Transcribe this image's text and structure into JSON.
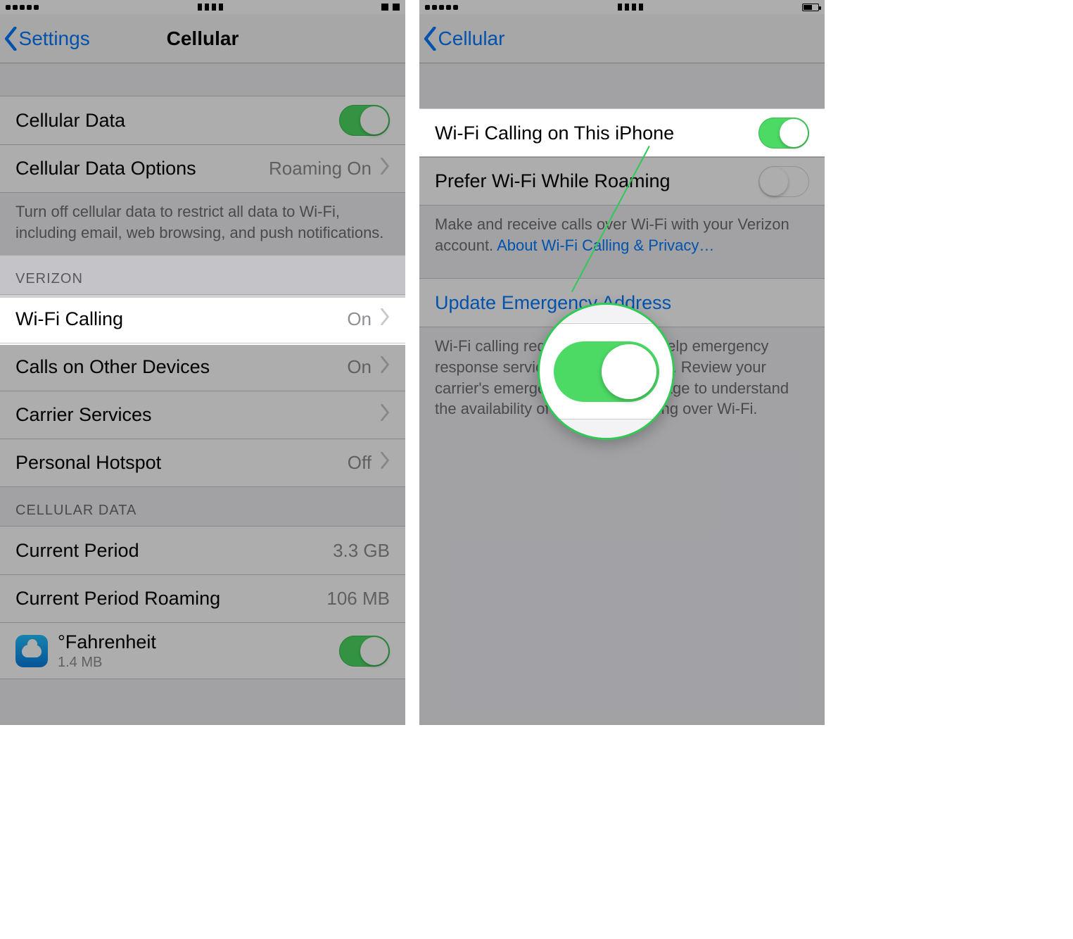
{
  "left": {
    "back_label": "Settings",
    "title": "Cellular",
    "cellular_data": "Cellular Data",
    "cellular_data_options": "Cellular Data Options",
    "cellular_data_options_value": "Roaming On",
    "data_footer": "Turn off cellular data to restrict all data to Wi-Fi, including email, web browsing, and push notifications.",
    "carrier_header": "VERIZON",
    "wifi_calling": "Wi-Fi Calling",
    "wifi_calling_value": "On",
    "calls_other": "Calls on Other Devices",
    "calls_other_value": "On",
    "carrier_services": "Carrier Services",
    "personal_hotspot": "Personal Hotspot",
    "personal_hotspot_value": "Off",
    "usage_header": "CELLULAR DATA",
    "current_period": "Current Period",
    "current_period_value": "3.3 GB",
    "current_roaming": "Current Period Roaming",
    "current_roaming_value": "106 MB",
    "app_name": "°Fahrenheit",
    "app_size": "1.4 MB"
  },
  "right": {
    "back_label": "Cellular",
    "wifi_on_iphone": "Wi-Fi Calling on This iPhone",
    "prefer_roam": "Prefer Wi-Fi While Roaming",
    "footer1_a": "Make and receive calls over Wi-Fi with your Verizon account. ",
    "footer1_link": "About Wi-Fi Calling & Privacy…",
    "update_addr": "Update Emergency Address",
    "footer2": "Wi-Fi calling requires location to help emergency response services respond to calls. Review your carrier's emergency calling web page to understand the availability of emergency calling over Wi-Fi."
  }
}
